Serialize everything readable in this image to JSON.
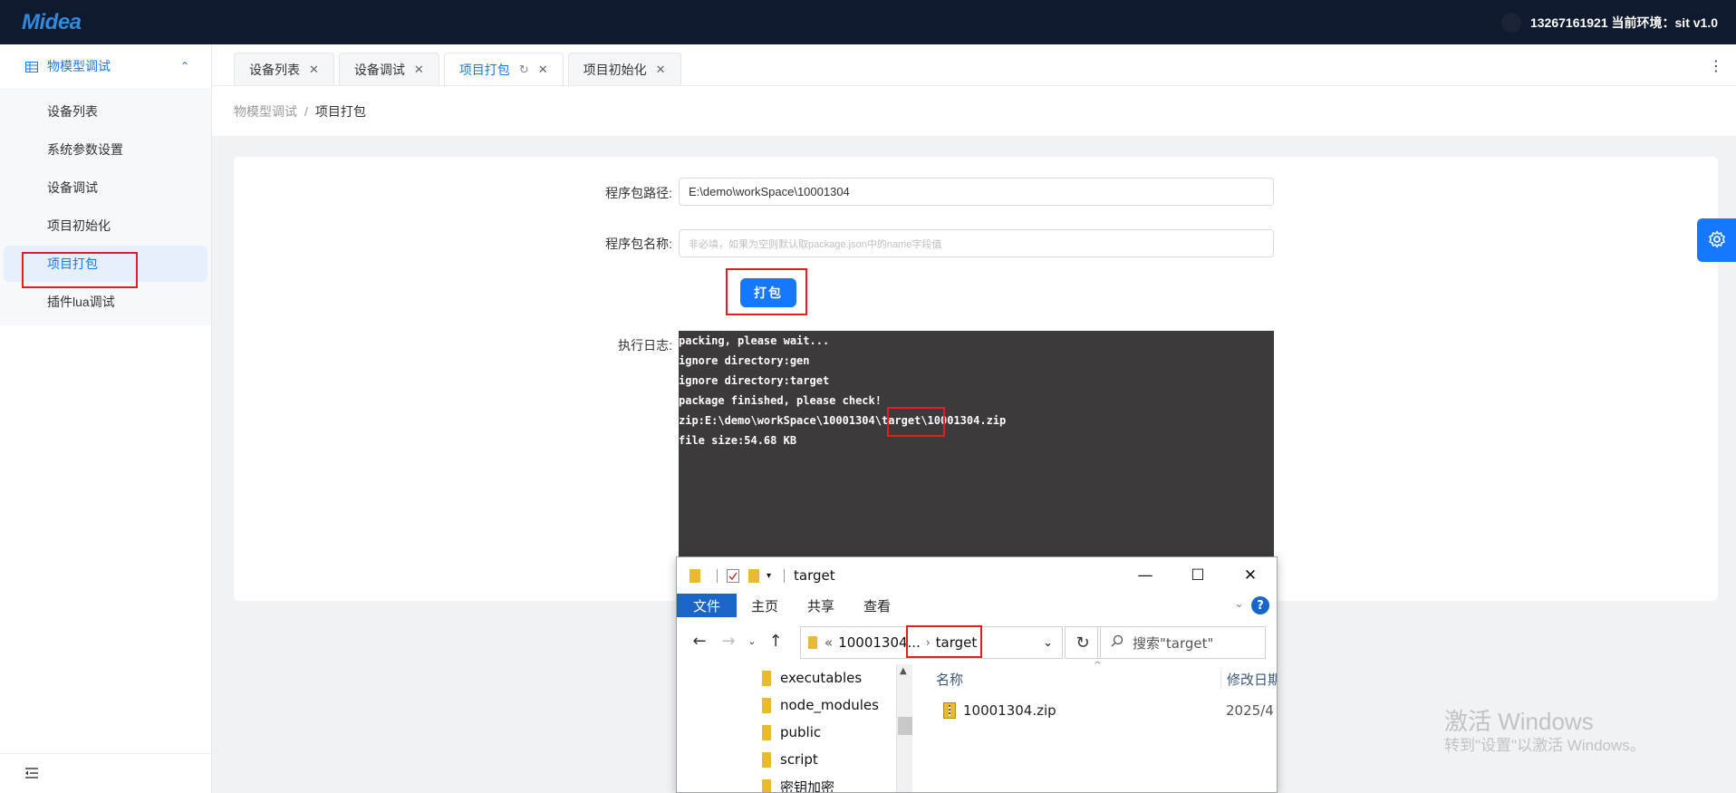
{
  "app": {
    "logo_text": "Midea",
    "user_env": "13267161921 当前环境：sit v1.0"
  },
  "sidebar": {
    "parent_label": "物模型调试",
    "items": [
      {
        "label": "设备列表"
      },
      {
        "label": "系统参数设置"
      },
      {
        "label": "设备调试"
      },
      {
        "label": "项目初始化"
      },
      {
        "label": "项目打包"
      },
      {
        "label": "插件lua调试"
      }
    ],
    "active_index": 4
  },
  "tabs": [
    {
      "label": "设备列表"
    },
    {
      "label": "设备调试"
    },
    {
      "label": "项目打包"
    },
    {
      "label": "项目初始化"
    }
  ],
  "breadcrumb": {
    "root": "物模型调试",
    "separator": "/",
    "current": "项目打包"
  },
  "form": {
    "path_label": "程序包路径:",
    "path_value": "E:\\demo\\workSpace\\10001304",
    "name_label": "程序包名称:",
    "name_placeholder": "非必填，如果为空则默认取package.json中的name字段值",
    "pack_button": "打包",
    "log_label": "执行日志:"
  },
  "log": {
    "lines": [
      "packing, please wait...",
      "ignore directory:gen",
      "ignore directory:target",
      "package finished, please check!"
    ],
    "zip_prefix": "zip:E:\\demo\\workSpace\\10001304",
    "zip_highlight": "\\target\\",
    "zip_suffix": "10001304.zip",
    "size_line": "file size:54.68 KB"
  },
  "explorer": {
    "title": "target",
    "ribbon": {
      "file": "文件",
      "home": "主页",
      "share": "共享",
      "view": "查看"
    },
    "address": {
      "parent": "10001304",
      "parent_display": "10001304...",
      "current": "target"
    },
    "search_placeholder": "搜索\"target\"",
    "nav_items": [
      "executables",
      "node_modules",
      "public",
      "script",
      "密钥加密"
    ],
    "columns": {
      "name": "名称",
      "modified": "修改日期"
    },
    "files": [
      {
        "name": "10001304.zip",
        "modified": "2025/4"
      }
    ]
  },
  "watermark": {
    "line1": "激活 Windows",
    "line2": "转到\"设置\"以激活 Windows。"
  },
  "colors": {
    "primary": "#1677ff",
    "topbar": "#0f1a2e",
    "log_bg": "#3c3a3a",
    "highlight_red": "#e02020",
    "explorer_file_tab": "#1a66c8",
    "folder_yellow": "#e8b931"
  }
}
